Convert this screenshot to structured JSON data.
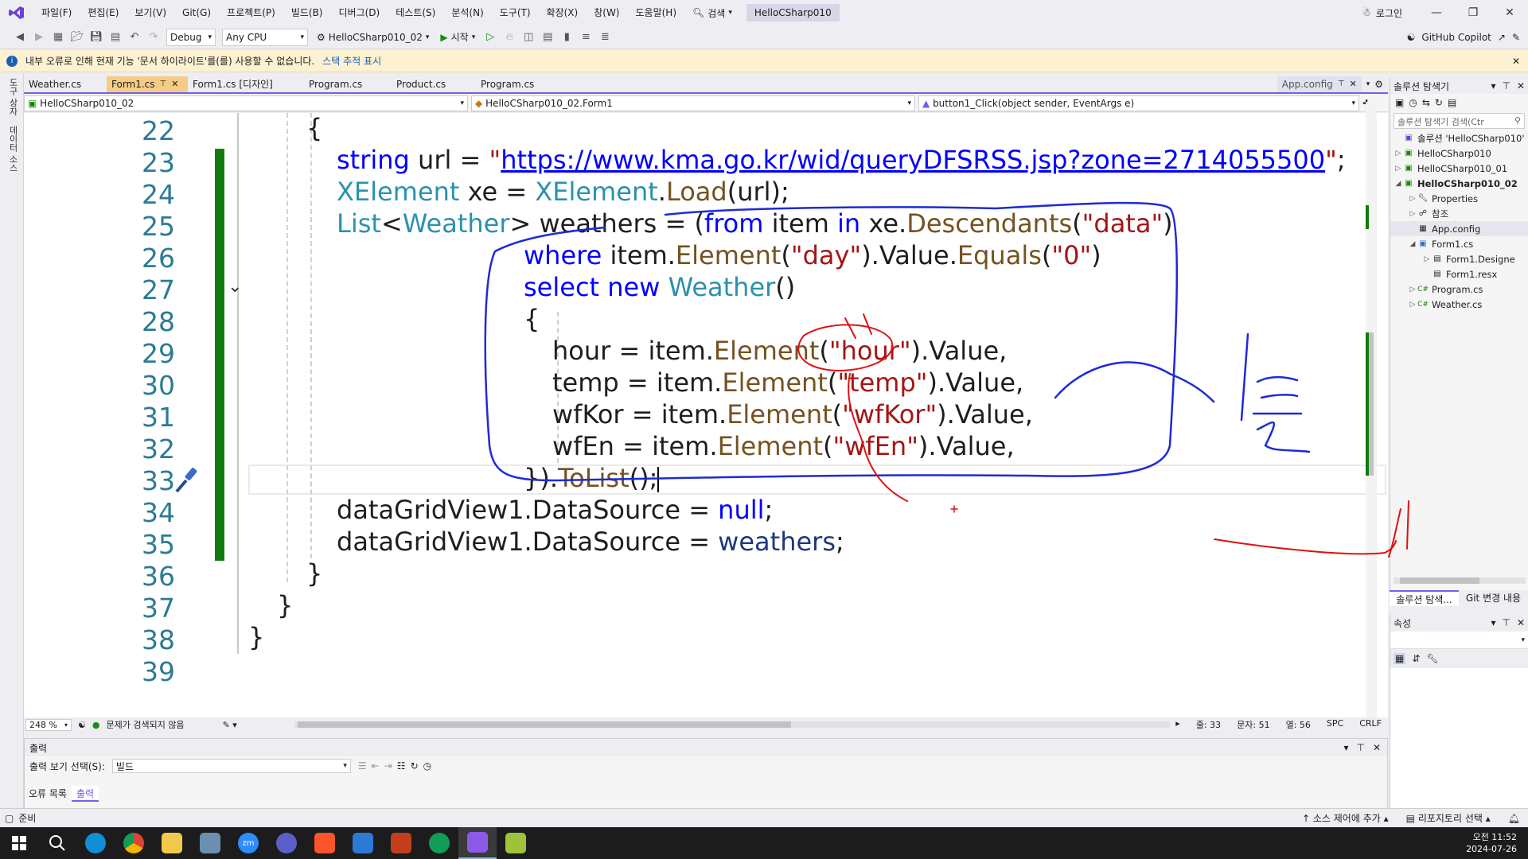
{
  "menubar": {
    "items": [
      "파일(F)",
      "편집(E)",
      "보기(V)",
      "Git(G)",
      "프로젝트(P)",
      "빌드(B)",
      "디버그(D)",
      "테스트(S)",
      "분석(N)",
      "도구(T)",
      "확장(X)",
      "창(W)",
      "도움말(H)"
    ],
    "search_label": "검색",
    "solution_name": "HelloCSharp010",
    "login_label": "로그인"
  },
  "toolbar": {
    "config": "Debug",
    "platform": "Any CPU",
    "startup_project": "HelloCSharp010_02",
    "start_label": "시작",
    "copilot_label": "GitHub Copilot"
  },
  "infobar": {
    "message": "내부 오류로 인해 현재 기능 '문서 하이라이트'를(를) 사용할 수 없습니다.",
    "link": "스택 추적 표시"
  },
  "leftstrip": {
    "items": [
      "도구 상자",
      "데이터 소스"
    ]
  },
  "tabs": [
    {
      "label": "Weather.cs",
      "active": false
    },
    {
      "label": "Form1.cs",
      "active": true
    },
    {
      "label": "Form1.cs [디자인]",
      "active": false
    },
    {
      "label": "Program.cs",
      "active": false
    },
    {
      "label": "Product.cs",
      "active": false
    },
    {
      "label": "Program.cs",
      "active": false
    }
  ],
  "right_tab": "App.config",
  "navbar": {
    "project": "HelloCSharp010_02",
    "class": "HelloCSharp010_02.Form1",
    "member": "button1_Click(object sender, EventArgs e)"
  },
  "editor": {
    "line_numbers": [
      "22",
      "23",
      "24",
      "25",
      "26",
      "27",
      "28",
      "29",
      "30",
      "31",
      "32",
      "33",
      "34",
      "35",
      "36",
      "37",
      "38",
      "39"
    ],
    "code": {
      "l22": "{",
      "l23_kw": "string",
      "l23_var": " url = ",
      "l23_q1": "\"",
      "l23_url": "https://www.kma.go.kr/wid/queryDFSRSS.jsp?zone=2714055500",
      "l23_q2": "\"",
      "l23_end": ";",
      "l24_ty1": "XElement",
      "l24_a": " xe = ",
      "l24_ty2": "XElement",
      "l24_b": ".",
      "l24_me": "Load",
      "l24_c": "(url);",
      "l25_ty1": "List",
      "l25_a": "<",
      "l25_ty2": "Weather",
      "l25_b": "> weathers = (",
      "l25_kw1": "from",
      "l25_c": " item ",
      "l25_kw2": "in",
      "l25_d": " xe.",
      "l25_me": "Descendants",
      "l25_e": "(",
      "l25_st": "\"data\"",
      "l25_f": ")",
      "l26_kw": "where",
      "l26_a": " item.",
      "l26_me1": "Element",
      "l26_b": "(",
      "l26_st1": "\"day\"",
      "l26_c": ").Value.",
      "l26_me2": "Equals",
      "l26_d": "(",
      "l26_st2": "\"0\"",
      "l26_e": ")",
      "l27_kw": "select new",
      "l27_sp": " ",
      "l27_ty": "Weather",
      "l27_a": "()",
      "l28": "{",
      "l29_a": "hour = item.",
      "l29_me": "Element",
      "l29_b": "(",
      "l29_st": "\"hour\"",
      "l29_c": ").Value,",
      "l30_a": "temp = item.",
      "l30_me": "Element",
      "l30_b": "(",
      "l30_st": "\"temp\"",
      "l30_c": ").Value,",
      "l31_a": "wfKor = item.",
      "l31_me": "Element",
      "l31_b": "(",
      "l31_st": "\"wfKor\"",
      "l31_c": ").Value,",
      "l32_a": "wfEn = item.",
      "l32_me": "Element",
      "l32_b": "(",
      "l32_st": "\"wfEn\"",
      "l32_c": ").Value,",
      "l33_a": "}).",
      "l33_me": "ToList",
      "l33_b": "();",
      "l34_a": "dataGridView1.DataSource = ",
      "l34_kw": "null",
      "l34_b": ";",
      "l35_a": "dataGridView1.DataSource = ",
      "l35_v": "weathers",
      "l35_b": ";",
      "l36": "}",
      "l37": "}",
      "l38": "}"
    }
  },
  "editor_status": {
    "zoom": "248 %",
    "issues": "문제가 검색되지 않음",
    "line": "줄: 33",
    "char": "문자: 51",
    "col": "열: 56",
    "spc": "SPC",
    "eol": "CRLF"
  },
  "output": {
    "title": "출력",
    "select_label": "출력 보기 선택(S):",
    "select_value": "빌드",
    "tabs": [
      "오류 목록",
      "출력"
    ]
  },
  "solution_explorer": {
    "title": "솔루션 탐색기",
    "search_placeholder": "솔루션 탐색기 검색(Ctr",
    "nodes": [
      {
        "label": "솔루션 'HelloCSharp010'",
        "bold": false
      },
      {
        "label": "HelloCSharp010",
        "bold": false
      },
      {
        "label": "HelloCSharp010_01",
        "bold": false
      },
      {
        "label": "HelloCSharp010_02",
        "bold": true
      },
      {
        "label": "Properties",
        "bold": false
      },
      {
        "label": "참조",
        "bold": false
      },
      {
        "label": "App.config",
        "bold": false
      },
      {
        "label": "Form1.cs",
        "bold": false
      },
      {
        "label": "Form1.Designe",
        "bold": false
      },
      {
        "label": "Form1.resx",
        "bold": false
      },
      {
        "label": "Program.cs",
        "bold": false
      },
      {
        "label": "Weather.cs",
        "bold": false
      }
    ],
    "tabs": [
      "솔루션 탐색...",
      "Git 변경 내용"
    ]
  },
  "properties": {
    "title": "속성"
  },
  "statusbar": {
    "ready": "준비",
    "source_control": "소스 제어에 추가",
    "repository": "리포지토리 선택"
  },
  "clock": {
    "time": "오전 11:52",
    "date": "2024-07-26"
  },
  "colors": {
    "accent": "#7160e8",
    "active_tab": "#f5cc84",
    "change_bar": "#107c10",
    "ink_blue": "#1d2bd6",
    "ink_red": "#e01010"
  }
}
